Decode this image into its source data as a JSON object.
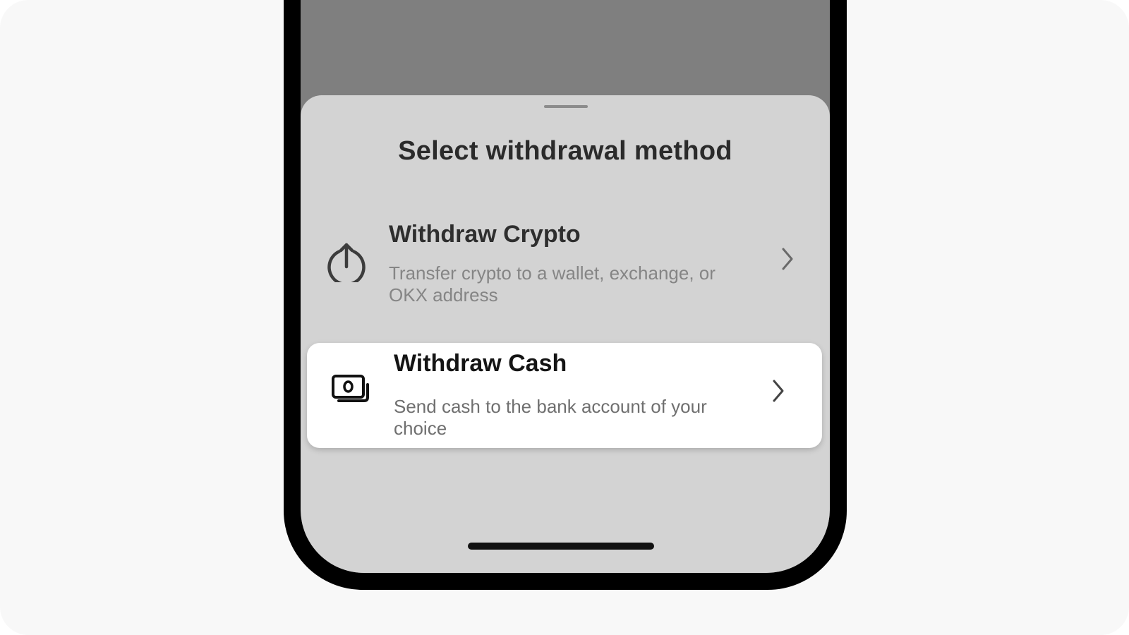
{
  "sheet": {
    "title": "Select withdrawal method",
    "options": [
      {
        "title": "Withdraw Crypto",
        "description": "Transfer crypto to a wallet, exchange, or OKX address",
        "icon": "upload-circle-icon",
        "highlighted": false
      },
      {
        "title": "Withdraw Cash",
        "description": "Send cash to the bank account of your choice",
        "icon": "cash-icon",
        "highlighted": true
      }
    ]
  },
  "colors": {
    "page_background": "#f8f8f8",
    "phone_frame": "#000000",
    "dimmed_backdrop": "#7f7f7f",
    "sheet_background": "#d3d3d3",
    "highlight_card": "#ffffff"
  }
}
